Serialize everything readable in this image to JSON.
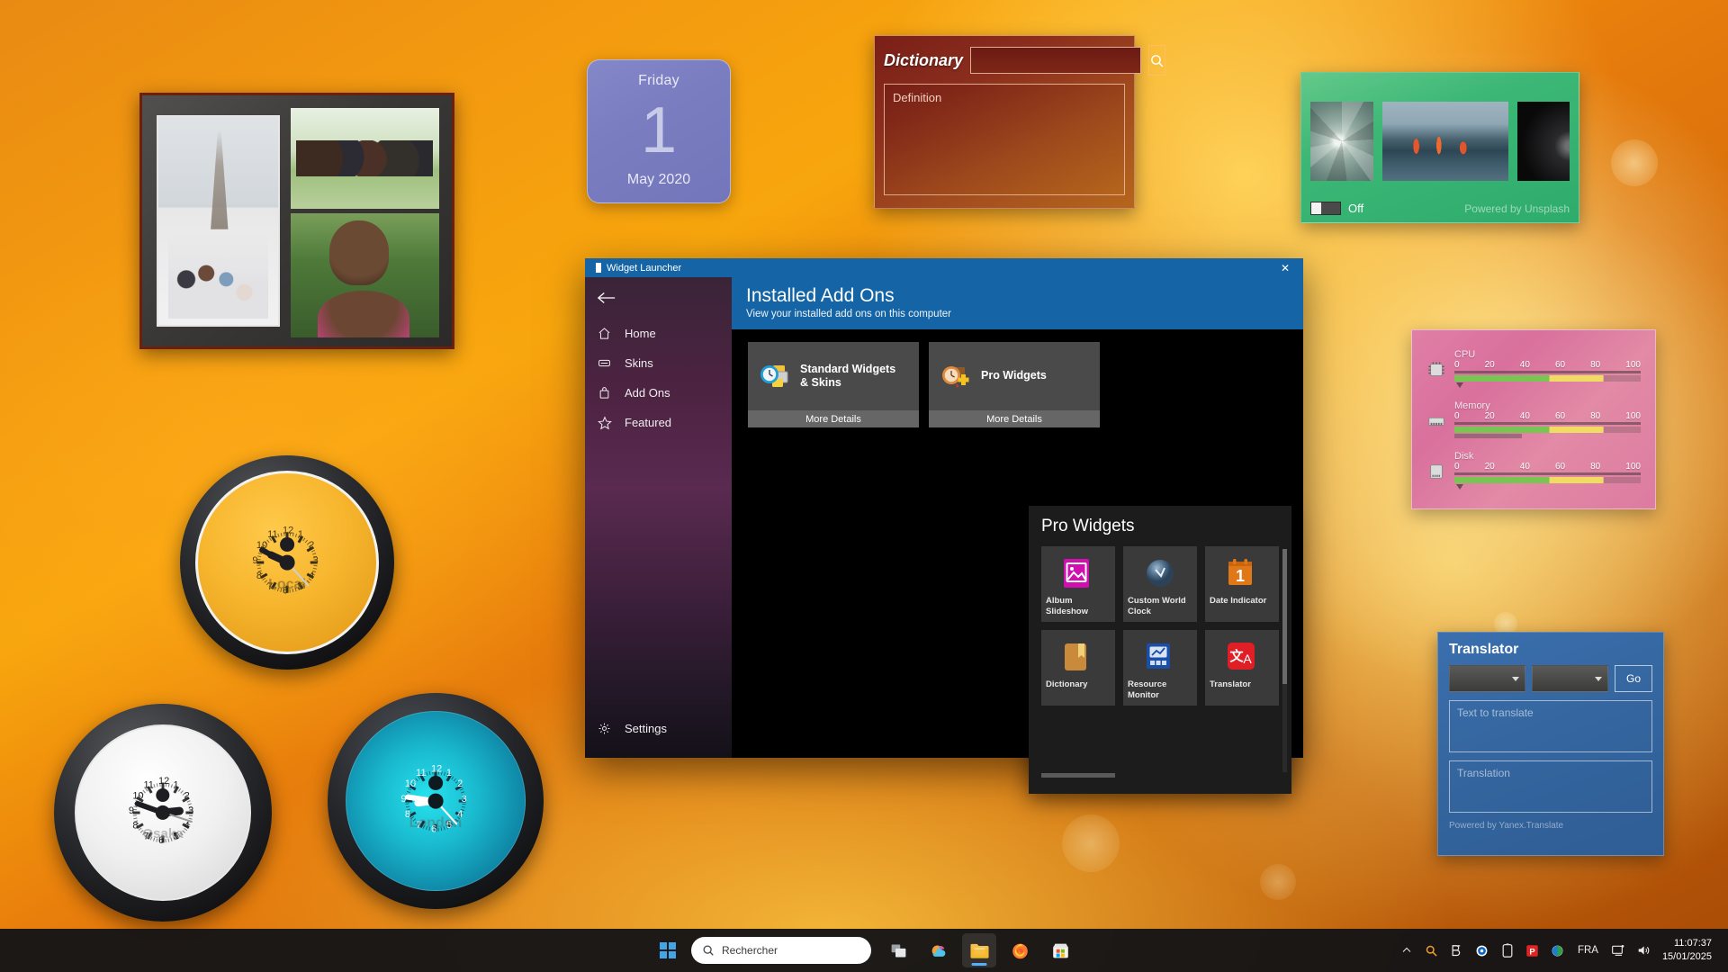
{
  "desktop": {
    "wallpaper_name": "orange-petal-macro"
  },
  "photo_frame": {
    "name": "Album Slideshow Frame",
    "photos": [
      "family-eiffel-tower",
      "children-on-grass",
      "father-and-daughter"
    ]
  },
  "date_widget": {
    "weekday": "Friday",
    "day": "1",
    "month_year": "May 2020"
  },
  "dictionary_widget": {
    "title": "Dictionary",
    "search_value": "",
    "search_placeholder": "",
    "definition_placeholder": "Definition",
    "search_icon": "magnifier-icon"
  },
  "album_widget": {
    "toggle_state": "Off",
    "credit": "Powered by Unsplash",
    "thumbnails": [
      "succulent-plant",
      "lava-meets-ocean",
      "dark-scene"
    ]
  },
  "resource_monitor": {
    "rows": [
      {
        "label": "CPU",
        "icon": "cpu-chip-icon",
        "ticks": [
          "0",
          "20",
          "40",
          "60",
          "80",
          "100"
        ],
        "value": 2
      },
      {
        "label": "Memory",
        "icon": "memory-ram-icon",
        "ticks": [
          "0",
          "20",
          "40",
          "60",
          "80",
          "100"
        ],
        "value": 36
      },
      {
        "label": "Disk",
        "icon": "hard-disk-icon",
        "ticks": [
          "0",
          "20",
          "40",
          "60",
          "80",
          "100"
        ],
        "value": 2
      }
    ]
  },
  "translator": {
    "title": "Translator",
    "source_language": "",
    "target_language": "",
    "go_label": "Go",
    "input_placeholder": "Text to translate",
    "output_placeholder": "Translation",
    "credit": "Powered by Yanex.Translate"
  },
  "clocks": [
    {
      "id": "local",
      "city": "Local",
      "hour": 9,
      "minute": 49,
      "second": 23
    },
    {
      "id": "osaka",
      "city": "Osaka",
      "hour": 2,
      "minute": 48,
      "second": 18
    },
    {
      "id": "london",
      "city": "London",
      "hour": 8,
      "minute": 46,
      "second": 23
    }
  ],
  "widget_launcher": {
    "window_title": "Widget Launcher",
    "close_label": "✕",
    "back_icon": "arrow-left-icon",
    "nav": [
      {
        "label": "Home",
        "icon": "home-icon"
      },
      {
        "label": "Skins",
        "icon": "skins-icon"
      },
      {
        "label": "Add Ons",
        "icon": "bag-icon"
      },
      {
        "label": "Featured",
        "icon": "star-icon"
      }
    ],
    "settings_label": "Settings",
    "settings_icon": "gear-icon",
    "header": {
      "title": "Installed Add Ons",
      "subtitle": "View your installed add ons on this computer"
    },
    "addon_cards": [
      {
        "title": "Standard Widgets\n& Skins",
        "title_line1": "Standard Widgets",
        "title_line2": "& Skins",
        "more_label": "More Details",
        "icon": "clock-folder-icon"
      },
      {
        "title": "Pro Widgets",
        "title_line1": "Pro Widgets",
        "title_line2": "",
        "more_label": "More Details",
        "icon": "clock-plus-icon"
      }
    ],
    "pro_panel": {
      "title": "Pro Widgets",
      "tiles": [
        {
          "label": "Album Slideshow",
          "icon": "picture-icon",
          "color": "#d10fb0"
        },
        {
          "label": "Custom World Clock",
          "icon": "world-clock-icon",
          "color": "#5b7fa8"
        },
        {
          "label": "Date Indicator",
          "icon": "calendar-icon",
          "color": "#e07818"
        },
        {
          "label": "Dictionary",
          "icon": "book-icon",
          "color": "#c98a3c"
        },
        {
          "label": "Resource Monitor",
          "icon": "gauge-icon",
          "color": "#1a4ea8"
        },
        {
          "label": "Translator",
          "icon": "translate-icon",
          "color": "#e01e26"
        }
      ]
    }
  },
  "taskbar": {
    "start_label": "Start",
    "start_icon": "windows-logo-icon",
    "search_placeholder": "Rechercher",
    "search_icon": "search-icon",
    "pinned": [
      {
        "name": "task-view",
        "icon": "task-view-icon"
      },
      {
        "name": "copilot",
        "icon": "copilot-icon"
      },
      {
        "name": "file-explorer",
        "icon": "folder-icon",
        "active": true
      },
      {
        "name": "firefox",
        "icon": "firefox-icon"
      },
      {
        "name": "microsoft-store",
        "icon": "store-icon"
      }
    ],
    "tray": [
      {
        "name": "show-hidden-icons",
        "icon": "chevron-up-icon"
      },
      {
        "name": "everything-search",
        "icon": "magnifier-orange-icon"
      },
      {
        "name": "bitdefender",
        "icon": "letter-b-icon"
      },
      {
        "name": "onedrive",
        "icon": "cloud-blue-icon"
      },
      {
        "name": "battery-app",
        "icon": "battery-icon"
      },
      {
        "name": "pdf-app",
        "icon": "letter-p-red-icon"
      },
      {
        "name": "security",
        "icon": "shield-green-icon"
      }
    ],
    "language": "FRA",
    "network_icon": "network-icon",
    "volume_icon": "speaker-icon",
    "time": "11:07:37",
    "date": "15/01/2025"
  }
}
